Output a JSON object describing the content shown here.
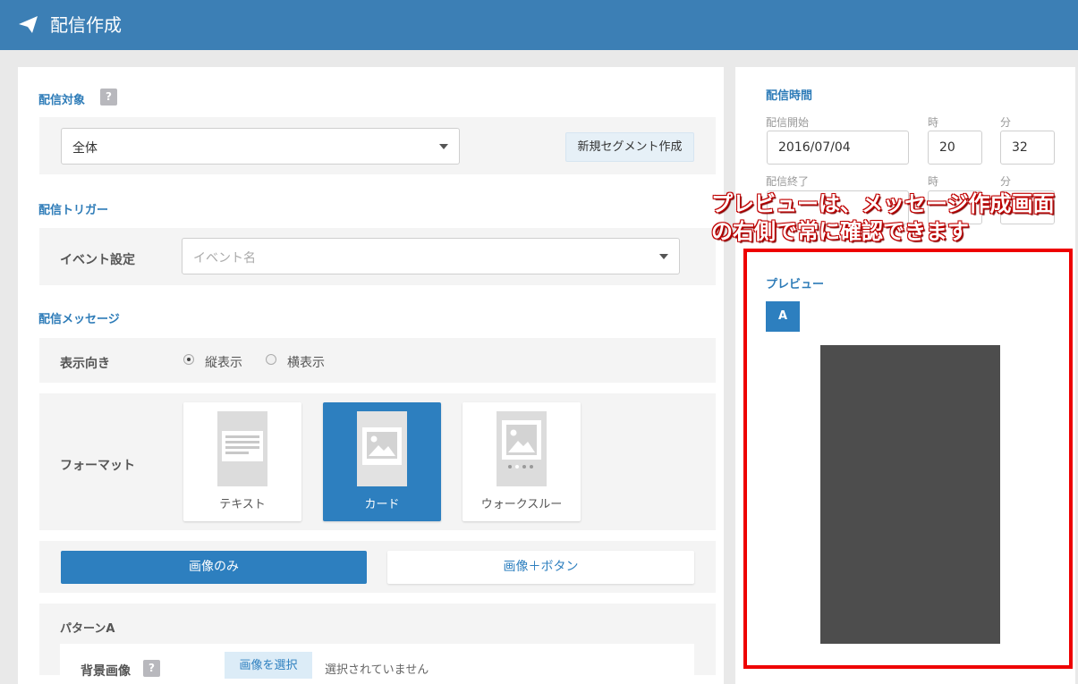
{
  "header": {
    "title": "配信作成",
    "icon": "paper-plane-icon"
  },
  "target": {
    "title": "配信対象",
    "help": "?",
    "selected": "全体",
    "new_segment_button": "新規セグメント作成"
  },
  "trigger": {
    "title": "配信トリガー",
    "event_label": "イベント設定",
    "event_placeholder": "イベント名"
  },
  "message": {
    "title": "配信メッセージ",
    "orientation_label": "表示向き",
    "orientation_options": [
      "縦表示",
      "横表示"
    ],
    "orientation_selected": "縦表示",
    "format_label": "フォーマット",
    "formats": [
      {
        "label": "テキスト",
        "icon": "text-doc-icon"
      },
      {
        "label": "カード",
        "icon": "image-card-icon"
      },
      {
        "label": "ウォークスルー",
        "icon": "walkthrough-icon"
      }
    ],
    "format_selected": "カード",
    "layout_buttons": [
      "画像のみ",
      "画像＋ボタン"
    ],
    "layout_selected": "画像のみ",
    "pattern_title": "パターンA",
    "bg_image_label": "背景画像",
    "bg_help": "?",
    "select_image_button": "画像を選択",
    "no_selection_text": "選択されていません"
  },
  "schedule": {
    "title": "配信時間",
    "start_label": "配信開始",
    "hour_label": "時",
    "minute_label": "分",
    "start_date": "2016/07/04",
    "start_hour": "20",
    "start_minute": "32",
    "end_label": "配信終了",
    "end_hour_label": "時",
    "end_minute_label": "分"
  },
  "preview": {
    "title": "プレビュー",
    "tab": "A"
  },
  "annotation": {
    "line1": "プレビューは、メッセージ作成画面",
    "line2": "の右側で常に確認できます",
    "color": "#ee0000"
  },
  "colors": {
    "header": "#3c7fb5",
    "accent": "#2d7fbf",
    "highlight": "#ee0000"
  }
}
